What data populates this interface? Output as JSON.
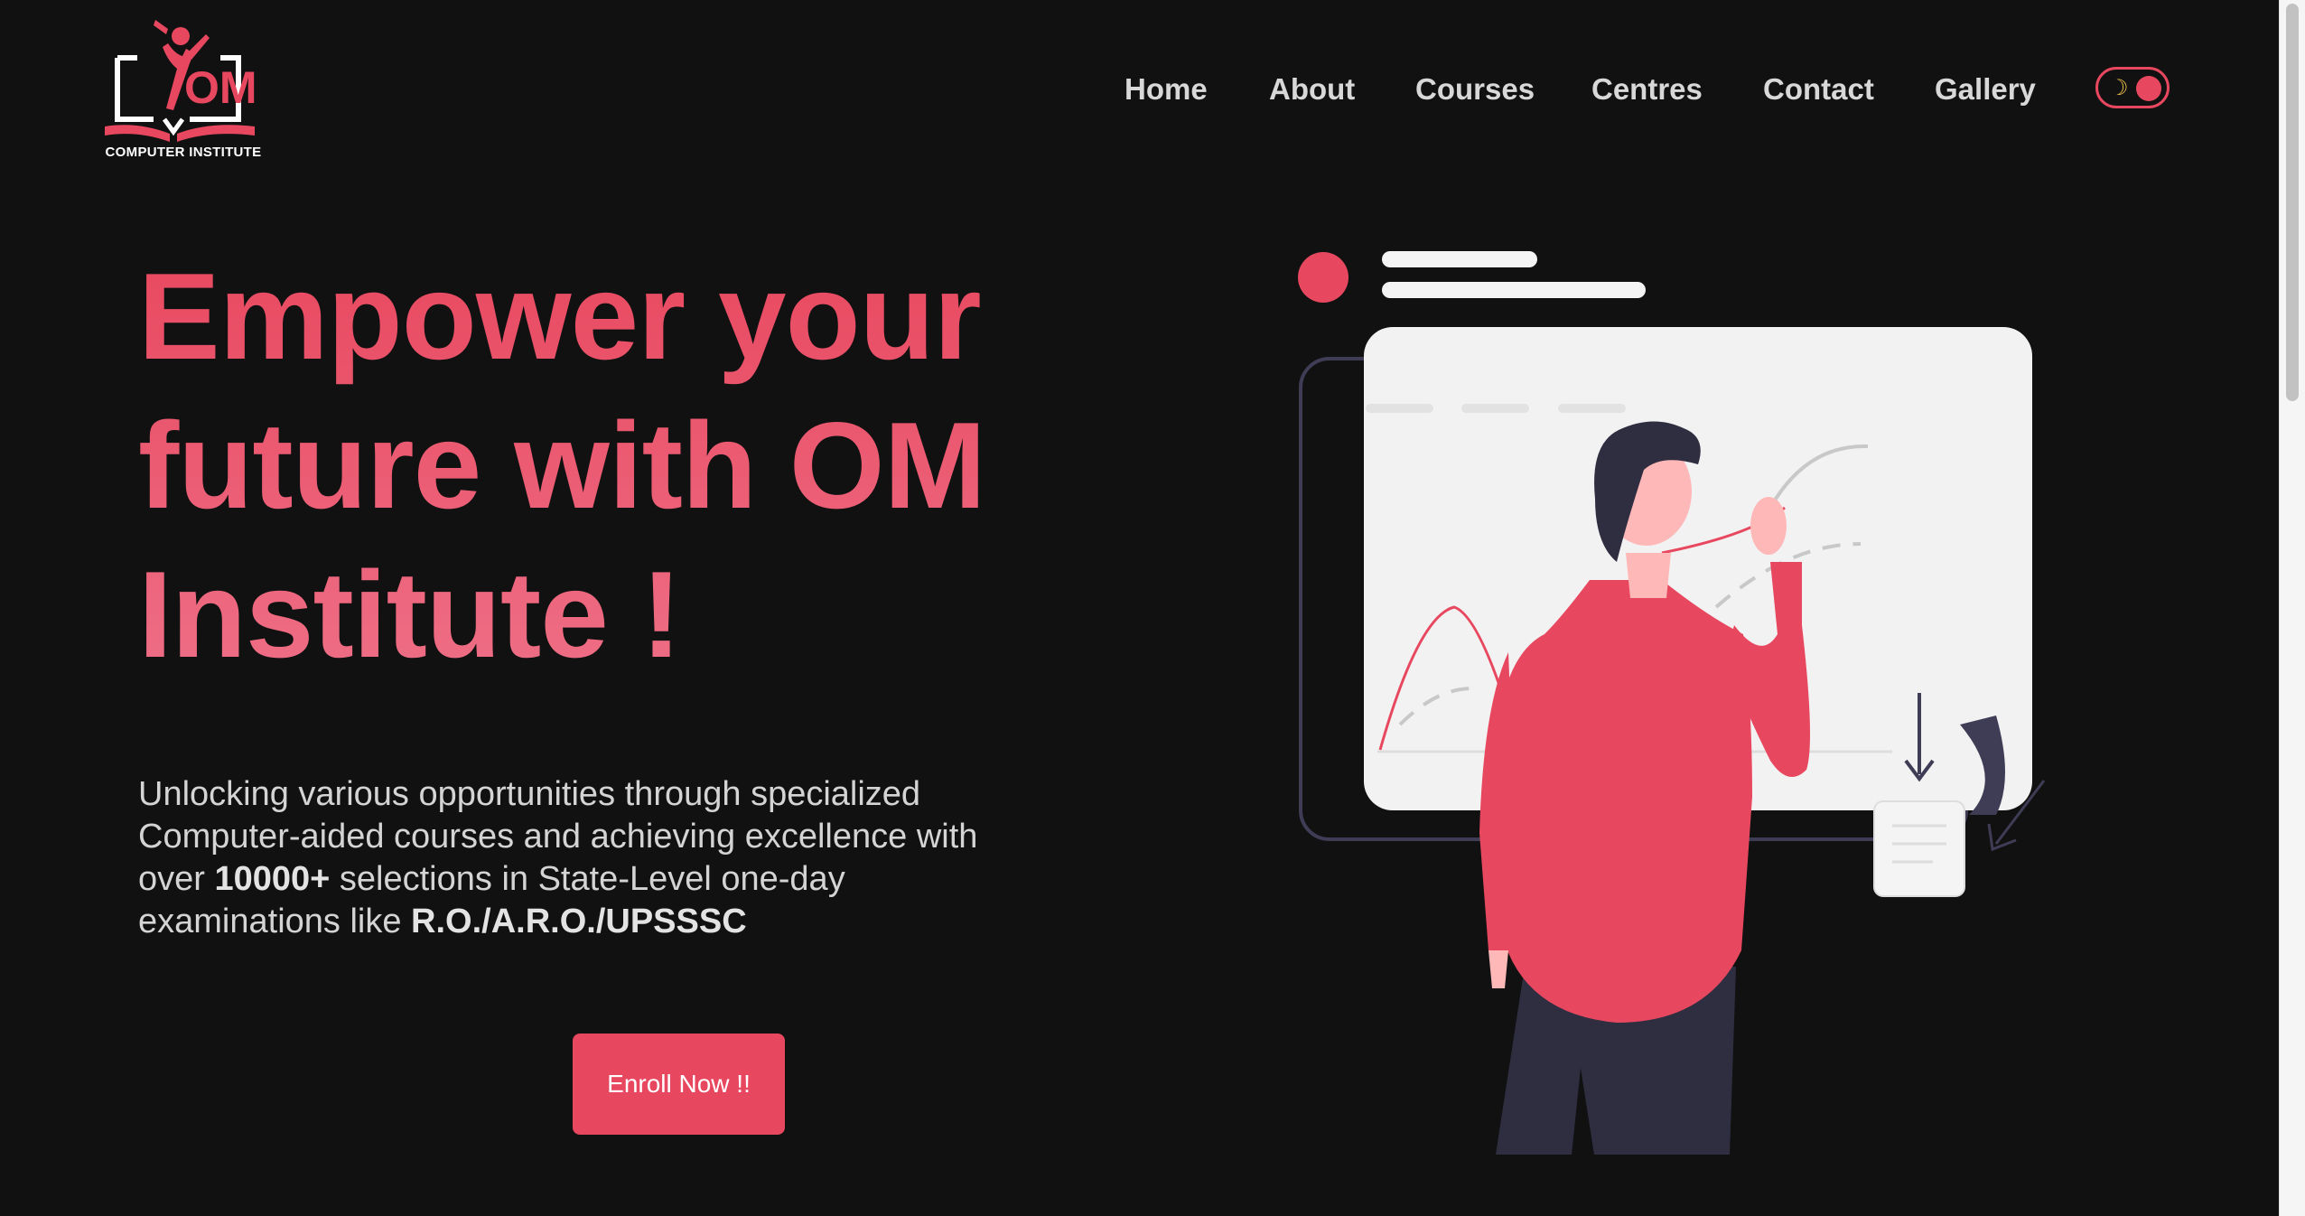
{
  "brand": {
    "logo_letters": "OM",
    "logo_subtitle": "COMPUTER INSTITUTE",
    "accent_color": "#e8485f"
  },
  "nav": {
    "items": [
      {
        "label": "Home"
      },
      {
        "label": "About"
      },
      {
        "label": "Courses"
      },
      {
        "label": "Centres"
      },
      {
        "label": "Contact"
      },
      {
        "label": "Gallery"
      }
    ],
    "theme_toggle_icon": "moon-icon"
  },
  "hero": {
    "title_lines": [
      "Empower your",
      "future with OM",
      "Institute !"
    ],
    "description": {
      "part1": "Unlocking various opportunities through specialized Computer-aided courses and achieving excellence with over ",
      "bold1": "10000+",
      "part2": " selections in State-Level one-day examinations like ",
      "bold2": "R.O./A.R.O./UPSSSC"
    },
    "cta_label": "Enroll Now !!"
  }
}
